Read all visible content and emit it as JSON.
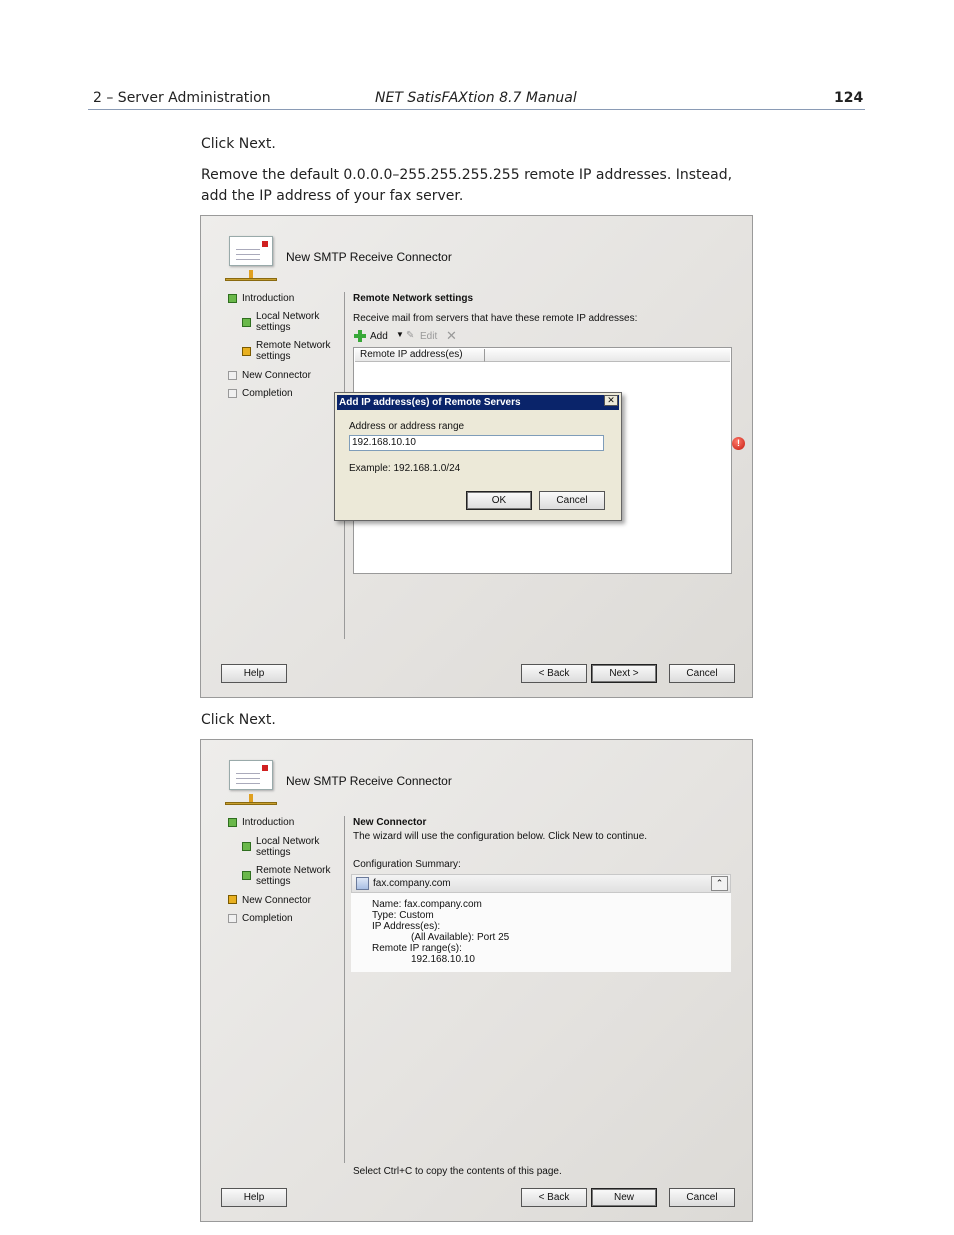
{
  "header": {
    "section": "2 – Server Administration",
    "title": "NET SatisFAXtion 8.7 Manual",
    "page_number": "124"
  },
  "body": {
    "para1": "Click Next.",
    "para2_line1": "Remove the default 0.0.0.0–255.255.255.255 remote IP addresses. Instead,",
    "para2_line2": "add the IP address of your fax server.",
    "para3": "Click Next."
  },
  "wizard1": {
    "title": "New SMTP Receive Connector",
    "nav": {
      "introduction": "Introduction",
      "local_network_1": "Local Network",
      "local_network_2": "settings",
      "remote_network_1": "Remote Network",
      "remote_network_2": "settings",
      "new_connector": "New Connector",
      "completion": "Completion"
    },
    "section_title": "Remote Network settings",
    "description": "Receive mail from servers that have these remote IP addresses:",
    "toolbar": {
      "add": "Add",
      "edit": "Edit"
    },
    "column_header": "Remote IP address(es)",
    "dialog": {
      "title": "Add IP address(es) of Remote Servers",
      "close": "✕",
      "label": "Address or address range",
      "value": "192.168.10.10",
      "example": "Example: 192.168.1.0/24",
      "ok": "OK",
      "cancel": "Cancel"
    },
    "buttons": {
      "help": "Help",
      "back": "< Back",
      "next": "Next >",
      "cancel": "Cancel"
    }
  },
  "wizard2": {
    "title": "New SMTP Receive Connector",
    "nav": {
      "introduction": "Introduction",
      "local_network_1": "Local Network",
      "local_network_2": "settings",
      "remote_network_1": "Remote Network",
      "remote_network_2": "settings",
      "new_connector": "New Connector",
      "completion": "Completion"
    },
    "section_title": "New Connector",
    "description": "The wizard will use the configuration below.  Click New to continue.",
    "config_label": "Configuration Summary:",
    "summary_header": "fax.company.com",
    "summary": {
      "name": "Name: fax.company.com",
      "type": "Type: Custom",
      "ip_label": "IP Address(es):",
      "ip_value": "(All Available): Port 25",
      "remote_label": "Remote IP range(s):",
      "remote_value": "192.168.10.10"
    },
    "copy_hint": "Select Ctrl+C to copy the contents of this page.",
    "buttons": {
      "help": "Help",
      "back": "< Back",
      "new": "New",
      "cancel": "Cancel"
    }
  },
  "colors": {
    "done": "#6ab84a",
    "current": "#e8b020",
    "dialog_titlebar": "#0a246a",
    "header_rule": "#8a9bb5"
  },
  "icons": [
    "wizard-icon",
    "add-icon",
    "edit-icon",
    "delete-icon",
    "warning-icon",
    "globe-icon",
    "collapse-icon",
    "close-icon"
  ]
}
